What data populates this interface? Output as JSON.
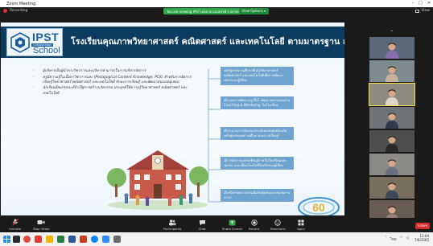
{
  "window": {
    "app_title": "Zoom Meeting"
  },
  "topbar": {
    "recording_label": "Recording",
    "share_banner_text": "You are viewing IPST เพจบาย แบบสรรค์ s screen",
    "view_options_label": "View Options ▾",
    "view_label": "View"
  },
  "slide": {
    "logo": {
      "ipst": "IPST",
      "collab": "Collaboration",
      "school": "School"
    },
    "title": "โรงเรียนคุณภาพวิทยาศาสตร์ คณิตศาสตร์ และเทคโนโลยี ตามมาตรฐาน สสวท.",
    "bullets": [
      "ผู้บริหารเป็นผู้นำทางวิชาการและบริหารสามารถในการบริหารจัดการ",
      "ครูมีความรู้ในเนื้อหาวิชาการและ (Pedagogical Content Knowledge: PCK) สำหรับการจัดการเรียนรู้วิทยาศาสตร์ คณิตศาสตร์ และเทคโนโลยี ทักษะการเรียนรู้ และพัฒนาตนเองอยู่เสมอ",
      "นักเรียนมีสมรรถนะที่จำเป็สู่การสร้างนวัตกรรม ประยุกต์ใช้ความรู้วิทยาศาสตร์ คณิตศาสตร์ และเทคโนโลยี"
    ],
    "boxes": [
      "หลักสูตรสถานศึกษาที่เน้นวิทยาศาสตร์ คณิตศาสตร์ และเทคโนโลยีเพื่อการพัฒนาสมรรถนะผู้เรียน",
      "มีระบบการพัฒนาครู PLC พัฒนาสมรรถนะผ่าน Coaching & Mentoring ในโรงเรียน",
      "มีกระบวนการจัดและประเมินผลสอดคล้องกับหลักสูตรของสถานศึกษาและการเรียนรู้",
      "มีการจัดการแหล่งเรียนรู้ภายในโรงเรียนและชุมชน และเชื่อมโยงกับชีวิตจริงของผู้เรียน",
      "มีเครือข่ายความร่วมมือกับชุมชนและหน่วยงานต่างๆ"
    ]
  },
  "participants": [
    {
      "name": "",
      "shirt": "#8a6fb0",
      "bg": "#5a6a7a"
    },
    {
      "name": "",
      "shirt": "#c9b29a",
      "bg": "#7d8a8f"
    },
    {
      "name": "",
      "shirt": "#e0d6c8",
      "bg": "#8d8a7e"
    },
    {
      "name": "",
      "shirt": "#2f3a4a",
      "bg": "#6e7478"
    },
    {
      "name": "",
      "shirt": "#2a2a2a",
      "bg": "#4e4e4e"
    },
    {
      "name": "",
      "shirt": "#6a7080",
      "bg": "#8b8a84"
    },
    {
      "name": "",
      "shirt": "#3a4a5a",
      "bg": "#7a6e5e"
    },
    {
      "name": "",
      "shirt": "#9a8070",
      "bg": "#6a5e52"
    }
  ],
  "toolbar": {
    "unmute_label": "Unmute",
    "stop_video_label": "Stop Video",
    "participants_label": "Participants",
    "participants_count": "30",
    "chat_label": "Chat",
    "share_screen_label": "Share Screen",
    "record_label": "Record",
    "reactions_label": "Reactions",
    "apps_label": "Apps",
    "leave_label": "Leave"
  },
  "taskbar": {
    "time": "11:04",
    "date": "7/6/2565",
    "lang": "ไทย"
  },
  "colors": {
    "slide_header": "#0d3c61",
    "box_fill": "#6ea4cf",
    "share_banner": "#2ea84a",
    "leave": "#d92d2d"
  }
}
